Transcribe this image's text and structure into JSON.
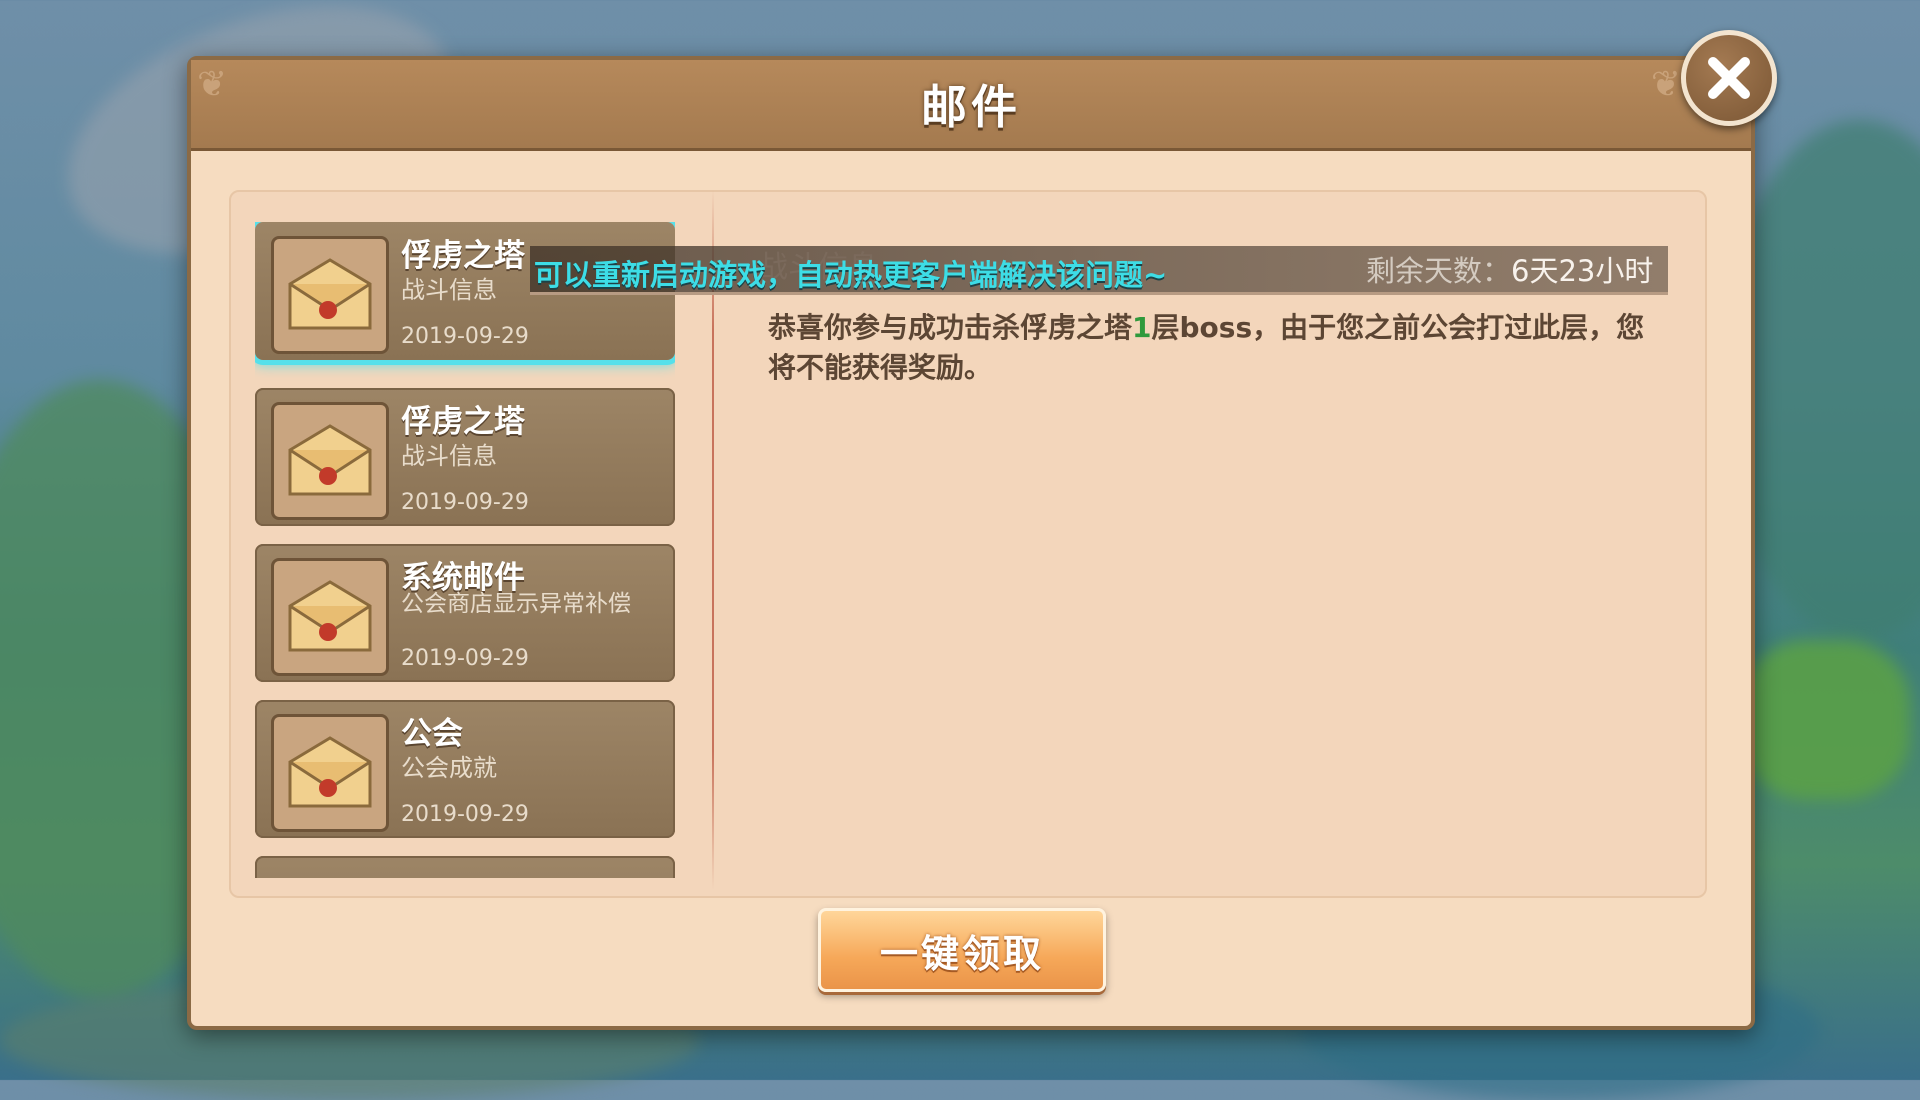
{
  "window": {
    "title": "邮件",
    "close_icon": "close-icon"
  },
  "mail_list": [
    {
      "title": "俘虏之塔",
      "subtitle": "战斗信息",
      "date": "2019-09-29",
      "selected": true
    },
    {
      "title": "俘虏之塔",
      "subtitle": "战斗信息",
      "date": "2019-09-29",
      "selected": false
    },
    {
      "title": "系统邮件",
      "subtitle": "公会商店显示异常补偿",
      "date": "2019-09-29",
      "selected": false
    },
    {
      "title": "公会",
      "subtitle": "公会成就",
      "date": "2019-09-29",
      "selected": false
    }
  ],
  "detail": {
    "sender": "战斗信息",
    "notice": "可以重新启动游戏，自动热更客户端解决该问题~",
    "remaining_label": "剩余天数：",
    "remaining_value": "6天23小时",
    "body_prefix": "恭喜你参与成功击杀俘虏之塔",
    "body_highlight": "1",
    "body_suffix": "层boss，由于您之前公会打过此层，您将不能获得奖励。"
  },
  "actions": {
    "claim_all": "一键领取"
  },
  "colors": {
    "accent_cyan": "#56e0ea",
    "header_brown": "#a47a4f",
    "panel_bg": "#f6dcc0",
    "highlight_green": "#2f9a3c"
  }
}
